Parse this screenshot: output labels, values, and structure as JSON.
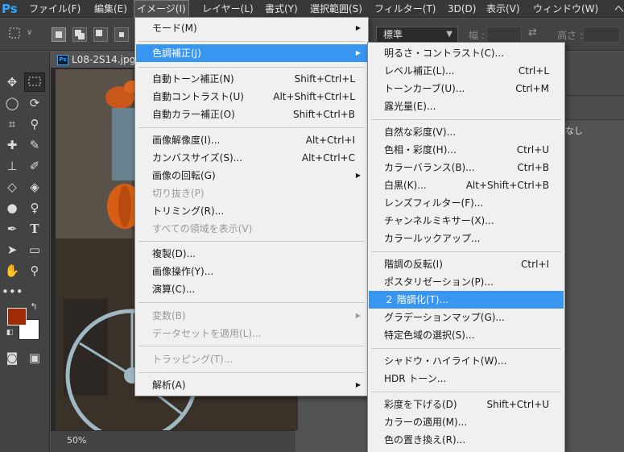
{
  "menubar": {
    "app_logo": "Ps",
    "items": [
      {
        "label": "ファイル(F)"
      },
      {
        "label": "編集(E)"
      },
      {
        "label": "イメージ(I)"
      },
      {
        "label": "レイヤー(L)"
      },
      {
        "label": "書式(Y)"
      },
      {
        "label": "選択範囲(S)"
      },
      {
        "label": "フィルター(T)"
      },
      {
        "label": "3D(D)"
      },
      {
        "label": "表示(V)"
      },
      {
        "label": "ウィンドウ(W)"
      },
      {
        "label": "ヘ"
      }
    ]
  },
  "options_bar": {
    "style_value": "標準",
    "width_label": "幅 :",
    "height_label": "高さ :"
  },
  "document": {
    "tab_icon": "Ps",
    "tab_title": "L08-2S14.jpg",
    "zoom": "50%"
  },
  "right_panel": {
    "partial_text": "なし"
  },
  "image_menu": {
    "items": [
      {
        "label": "モード(M)",
        "shortcut": "",
        "submenu": true
      },
      {
        "label": "色調補正(J)",
        "shortcut": "",
        "submenu": true,
        "highlighted": true
      },
      {
        "label": "自動トーン補正(N)",
        "shortcut": "Shift+Ctrl+L"
      },
      {
        "label": "自動コントラスト(U)",
        "shortcut": "Alt+Shift+Ctrl+L"
      },
      {
        "label": "自動カラー補正(O)",
        "shortcut": "Shift+Ctrl+B"
      },
      {
        "label": "画像解像度(I)...",
        "shortcut": "Alt+Ctrl+I"
      },
      {
        "label": "カンバスサイズ(S)...",
        "shortcut": "Alt+Ctrl+C"
      },
      {
        "label": "画像の回転(G)",
        "shortcut": "",
        "submenu": true
      },
      {
        "label": "切り抜き(P)",
        "shortcut": "",
        "disabled": true
      },
      {
        "label": "トリミング(R)...",
        "shortcut": ""
      },
      {
        "label": "すべての領域を表示(V)",
        "shortcut": "",
        "disabled": true
      },
      {
        "label": "複製(D)...",
        "shortcut": ""
      },
      {
        "label": "画像操作(Y)...",
        "shortcut": ""
      },
      {
        "label": "演算(C)...",
        "shortcut": ""
      },
      {
        "label": "変数(B)",
        "shortcut": "",
        "submenu": true,
        "disabled": true
      },
      {
        "label": "データセットを適用(L)...",
        "shortcut": "",
        "disabled": true
      },
      {
        "label": "トラッピング(T)...",
        "shortcut": "",
        "disabled": true
      },
      {
        "label": "解析(A)",
        "shortcut": "",
        "submenu": true
      }
    ]
  },
  "adjustments_menu": {
    "items": [
      {
        "label": "明るさ・コントラスト(C)...",
        "shortcut": ""
      },
      {
        "label": "レベル補正(L)...",
        "shortcut": "Ctrl+L"
      },
      {
        "label": "トーンカーブ(U)...",
        "shortcut": "Ctrl+M"
      },
      {
        "label": "露光量(E)...",
        "shortcut": ""
      },
      {
        "label": "自然な彩度(V)...",
        "shortcut": ""
      },
      {
        "label": "色相・彩度(H)...",
        "shortcut": "Ctrl+U"
      },
      {
        "label": "カラーバランス(B)...",
        "shortcut": "Ctrl+B"
      },
      {
        "label": "白黒(K)...",
        "shortcut": "Alt+Shift+Ctrl+B"
      },
      {
        "label": "レンズフィルター(F)...",
        "shortcut": ""
      },
      {
        "label": "チャンネルミキサー(X)...",
        "shortcut": ""
      },
      {
        "label": "カラールックアップ...",
        "shortcut": ""
      },
      {
        "label": "階調の反転(I)",
        "shortcut": "Ctrl+I"
      },
      {
        "label": "ポスタリゼーション(P)...",
        "shortcut": ""
      },
      {
        "label": "２ 階調化(T)...",
        "shortcut": "",
        "highlighted": true
      },
      {
        "label": "グラデーションマップ(G)...",
        "shortcut": ""
      },
      {
        "label": "特定色域の選択(S)...",
        "shortcut": ""
      },
      {
        "label": "シャドウ・ハイライト(W)...",
        "shortcut": ""
      },
      {
        "label": "HDR トーン...",
        "shortcut": ""
      },
      {
        "label": "彩度を下げる(D)",
        "shortcut": "Shift+Ctrl+U"
      },
      {
        "label": "カラーの適用(M)...",
        "shortcut": ""
      },
      {
        "label": "色の置き換え(R)...",
        "shortcut": ""
      }
    ]
  },
  "colors": {
    "foreground": "#a02a05",
    "background": "#ffffff",
    "highlight": "#3895f0",
    "menubar": "#383838",
    "menu_bg": "#f0f0f0"
  }
}
